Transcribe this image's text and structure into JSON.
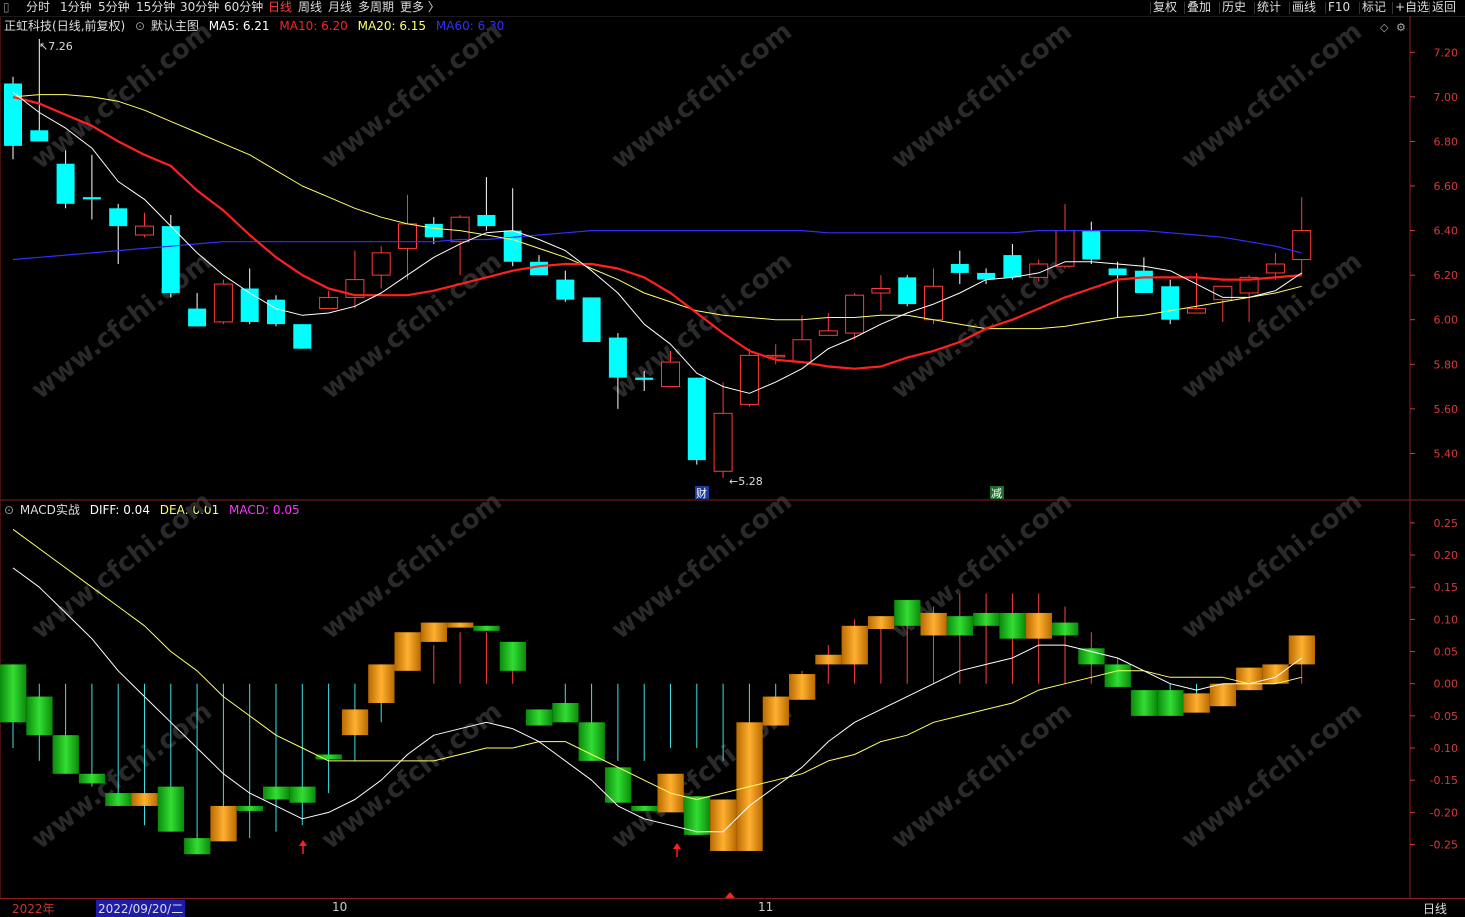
{
  "toolbar": {
    "periods": [
      {
        "label": "分时",
        "active": false
      },
      {
        "label": "1分钟",
        "active": false
      },
      {
        "label": "5分钟",
        "active": false
      },
      {
        "label": "15分钟",
        "active": false
      },
      {
        "label": "30分钟",
        "active": false
      },
      {
        "label": "60分钟",
        "active": false
      },
      {
        "label": "日线",
        "active": true
      },
      {
        "label": "周线",
        "active": false
      },
      {
        "label": "月线",
        "active": false
      },
      {
        "label": "多周期",
        "active": false
      },
      {
        "label": "更多 〉",
        "active": false
      }
    ],
    "right_buttons": [
      "复权",
      "叠加",
      "历史",
      "统计",
      "画线",
      "F10",
      "标记",
      "+自选",
      "返回"
    ]
  },
  "main_legend": {
    "stock": "正虹科技",
    "mode": "(日线,前复权)",
    "template": "默认主图",
    "ma5_label": "MA5:",
    "ma5_value": "6.21",
    "ma10_label": "MA10:",
    "ma10_value": "6.20",
    "ma20_label": "MA20:",
    "ma20_value": "6.15",
    "ma60_label": "MA60:",
    "ma60_value": "6.30"
  },
  "sub_legend": {
    "name": "MACD实战",
    "diff_label": "DIFF:",
    "diff_value": "0.04",
    "dea_label": "DEA:",
    "dea_value": "0.01",
    "macd_label": "MACD:",
    "macd_value": "0.05"
  },
  "price_axis": [
    "7.20",
    "7.00",
    "6.80",
    "6.60",
    "6.40",
    "6.20",
    "6.00",
    "5.80",
    "5.60",
    "5.40"
  ],
  "macd_axis": [
    "0.25",
    "0.20",
    "0.15",
    "0.10",
    "0.05",
    "0.00",
    "-0.05",
    "-0.10",
    "-0.15",
    "-0.20",
    "-0.25"
  ],
  "annotations": {
    "high_label": "7.26",
    "low_label": "5.28",
    "event_cai": "财",
    "event_jian": "减"
  },
  "watermark": "www.cfchi.com",
  "bottom": {
    "year": "2022年",
    "cursor_date": "2022/09/20/二",
    "month_oct": "10",
    "month_nov": "11",
    "period": "日线"
  },
  "colors": {
    "up": "#ff3a3a",
    "down": "#00ffff",
    "ma5": "#ffffff",
    "ma10": "#ff2020",
    "ma20": "#ffff66",
    "ma60": "#3030ff",
    "axis": "#d43c3c"
  },
  "chart_data": {
    "type": "candlestick",
    "price_ylim": [
      5.2,
      7.3
    ],
    "candles": [
      {
        "o": 7.06,
        "c": 6.78,
        "h": 7.09,
        "l": 6.72
      },
      {
        "o": 6.85,
        "c": 6.8,
        "h": 7.26,
        "l": 6.8
      },
      {
        "o": 6.7,
        "c": 6.52,
        "h": 6.76,
        "l": 6.5
      },
      {
        "o": 6.55,
        "c": 6.54,
        "h": 6.74,
        "l": 6.45
      },
      {
        "o": 6.5,
        "c": 6.42,
        "h": 6.52,
        "l": 6.25
      },
      {
        "o": 6.38,
        "c": 6.42,
        "h": 6.48,
        "l": 6.37
      },
      {
        "o": 6.42,
        "c": 6.12,
        "h": 6.47,
        "l": 6.1
      },
      {
        "o": 6.05,
        "c": 5.97,
        "h": 6.12,
        "l": 5.97
      },
      {
        "o": 5.99,
        "c": 6.16,
        "h": 6.18,
        "l": 5.98
      },
      {
        "o": 6.14,
        "c": 5.99,
        "h": 6.23,
        "l": 5.98
      },
      {
        "o": 6.09,
        "c": 5.98,
        "h": 6.11,
        "l": 5.97
      },
      {
        "o": 5.98,
        "c": 5.87,
        "h": 5.98,
        "l": 5.87
      },
      {
        "o": 6.05,
        "c": 6.1,
        "h": 6.13,
        "l": 6.05
      },
      {
        "o": 6.1,
        "c": 6.18,
        "h": 6.31,
        "l": 6.05
      },
      {
        "o": 6.2,
        "c": 6.3,
        "h": 6.33,
        "l": 6.14
      },
      {
        "o": 6.32,
        "c": 6.43,
        "h": 6.56,
        "l": 6.18
      },
      {
        "o": 6.43,
        "c": 6.37,
        "h": 6.46,
        "l": 6.34
      },
      {
        "o": 6.35,
        "c": 6.46,
        "h": 6.47,
        "l": 6.2
      },
      {
        "o": 6.47,
        "c": 6.42,
        "h": 6.64,
        "l": 6.4
      },
      {
        "o": 6.4,
        "c": 6.26,
        "h": 6.59,
        "l": 6.24
      },
      {
        "o": 6.26,
        "c": 6.2,
        "h": 6.29,
        "l": 6.2
      },
      {
        "o": 6.18,
        "c": 6.09,
        "h": 6.22,
        "l": 6.08
      },
      {
        "o": 6.1,
        "c": 5.9,
        "h": 6.1,
        "l": 5.9
      },
      {
        "o": 5.92,
        "c": 5.74,
        "h": 5.94,
        "l": 5.6
      },
      {
        "o": 5.74,
        "c": 5.73,
        "h": 5.77,
        "l": 5.68
      },
      {
        "o": 5.7,
        "c": 5.81,
        "h": 5.86,
        "l": 5.7
      },
      {
        "o": 5.74,
        "c": 5.37,
        "h": 5.74,
        "l": 5.35
      },
      {
        "o": 5.32,
        "c": 5.58,
        "h": 5.72,
        "l": 5.29
      },
      {
        "o": 5.62,
        "c": 5.84,
        "h": 5.87,
        "l": 5.61
      },
      {
        "o": 5.84,
        "c": 5.84,
        "h": 5.89,
        "l": 5.8
      },
      {
        "o": 5.81,
        "c": 5.91,
        "h": 6.02,
        "l": 5.81
      },
      {
        "o": 5.93,
        "c": 5.95,
        "h": 6.03,
        "l": 5.93
      },
      {
        "o": 5.94,
        "c": 6.11,
        "h": 6.12,
        "l": 5.91
      },
      {
        "o": 6.12,
        "c": 6.14,
        "h": 6.2,
        "l": 6.04
      },
      {
        "o": 6.19,
        "c": 6.07,
        "h": 6.2,
        "l": 6.06
      },
      {
        "o": 6.0,
        "c": 6.15,
        "h": 6.23,
        "l": 5.98
      },
      {
        "o": 6.25,
        "c": 6.21,
        "h": 6.31,
        "l": 6.16
      },
      {
        "o": 6.21,
        "c": 6.18,
        "h": 6.23,
        "l": 6.16
      },
      {
        "o": 6.29,
        "c": 6.19,
        "h": 6.34,
        "l": 6.18
      },
      {
        "o": 6.19,
        "c": 6.25,
        "h": 6.27,
        "l": 6.17
      },
      {
        "o": 6.24,
        "c": 6.4,
        "h": 6.52,
        "l": 6.23
      },
      {
        "o": 6.4,
        "c": 6.27,
        "h": 6.44,
        "l": 6.25
      },
      {
        "o": 6.23,
        "c": 6.2,
        "h": 6.26,
        "l": 6.01
      },
      {
        "o": 6.22,
        "c": 6.12,
        "h": 6.28,
        "l": 6.12
      },
      {
        "o": 6.15,
        "c": 6.0,
        "h": 6.18,
        "l": 5.98
      },
      {
        "o": 6.03,
        "c": 6.05,
        "h": 6.21,
        "l": 6.03
      },
      {
        "o": 6.09,
        "c": 6.15,
        "h": 6.15,
        "l": 5.99
      },
      {
        "o": 6.12,
        "c": 6.19,
        "h": 6.2,
        "l": 5.99
      },
      {
        "o": 6.21,
        "c": 6.25,
        "h": 6.3,
        "l": 6.18
      },
      {
        "o": 6.27,
        "c": 6.4,
        "h": 6.55,
        "l": 6.2
      }
    ],
    "ma5": [
      7.02,
      6.93,
      6.86,
      6.77,
      6.62,
      6.54,
      6.42,
      6.3,
      6.2,
      6.12,
      6.05,
      6.02,
      6.03,
      6.06,
      6.12,
      6.2,
      6.28,
      6.34,
      6.39,
      6.4,
      6.36,
      6.31,
      6.22,
      6.12,
      5.98,
      5.89,
      5.76,
      5.7,
      5.67,
      5.72,
      5.78,
      5.87,
      5.92,
      5.98,
      6.03,
      6.07,
      6.12,
      6.18,
      6.19,
      6.21,
      6.26,
      6.26,
      6.25,
      6.24,
      6.22,
      6.16,
      6.1,
      6.1,
      6.13,
      6.21
    ],
    "ma10": [
      7.0,
      6.97,
      6.92,
      6.87,
      6.8,
      6.74,
      6.69,
      6.58,
      6.49,
      6.38,
      6.28,
      6.2,
      6.14,
      6.11,
      6.11,
      6.11,
      6.13,
      6.16,
      6.19,
      6.22,
      6.24,
      6.25,
      6.25,
      6.23,
      6.19,
      6.12,
      6.03,
      5.94,
      5.86,
      5.82,
      5.81,
      5.79,
      5.78,
      5.79,
      5.83,
      5.86,
      5.9,
      5.96,
      6.0,
      6.05,
      6.1,
      6.14,
      6.18,
      6.19,
      6.19,
      6.19,
      6.18,
      6.18,
      6.19,
      6.2
    ],
    "ma20": [
      7.0,
      7.01,
      7.01,
      7.0,
      6.98,
      6.94,
      6.89,
      6.84,
      6.79,
      6.74,
      6.67,
      6.6,
      6.55,
      6.5,
      6.46,
      6.43,
      6.41,
      6.4,
      6.38,
      6.36,
      6.32,
      6.28,
      6.23,
      6.18,
      6.12,
      6.08,
      6.04,
      6.02,
      6.01,
      6.0,
      6.0,
      6.01,
      6.01,
      6.02,
      6.02,
      6.0,
      5.98,
      5.96,
      5.96,
      5.96,
      5.97,
      5.99,
      6.01,
      6.02,
      6.04,
      6.06,
      6.08,
      6.1,
      6.12,
      6.15
    ],
    "ma60": [
      6.27,
      6.28,
      6.29,
      6.3,
      6.31,
      6.32,
      6.33,
      6.34,
      6.35,
      6.35,
      6.35,
      6.35,
      6.35,
      6.35,
      6.35,
      6.35,
      6.35,
      6.36,
      6.36,
      6.37,
      6.38,
      6.39,
      6.4,
      6.4,
      6.4,
      6.4,
      6.4,
      6.4,
      6.4,
      6.4,
      6.4,
      6.39,
      6.39,
      6.39,
      6.39,
      6.39,
      6.39,
      6.39,
      6.39,
      6.4,
      6.4,
      6.4,
      6.4,
      6.4,
      6.39,
      6.38,
      6.37,
      6.35,
      6.33,
      6.3
    ],
    "macd_ylim": [
      -0.33,
      0.27
    ],
    "diff": [
      0.18,
      0.15,
      0.11,
      0.07,
      0.02,
      -0.02,
      -0.06,
      -0.1,
      -0.14,
      -0.17,
      -0.19,
      -0.21,
      -0.2,
      -0.18,
      -0.15,
      -0.11,
      -0.08,
      -0.07,
      -0.06,
      -0.07,
      -0.09,
      -0.12,
      -0.15,
      -0.19,
      -0.21,
      -0.22,
      -0.23,
      -0.23,
      -0.19,
      -0.16,
      -0.13,
      -0.09,
      -0.06,
      -0.04,
      -0.02,
      0.0,
      0.02,
      0.03,
      0.04,
      0.06,
      0.06,
      0.05,
      0.04,
      0.02,
      0.0,
      -0.01,
      0.0,
      0.0,
      0.01,
      0.04
    ],
    "dea": [
      0.24,
      0.21,
      0.18,
      0.15,
      0.12,
      0.09,
      0.05,
      0.02,
      -0.02,
      -0.05,
      -0.08,
      -0.1,
      -0.12,
      -0.12,
      -0.12,
      -0.12,
      -0.12,
      -0.11,
      -0.1,
      -0.1,
      -0.09,
      -0.09,
      -0.11,
      -0.13,
      -0.15,
      -0.17,
      -0.18,
      -0.17,
      -0.16,
      -0.15,
      -0.14,
      -0.12,
      -0.11,
      -0.09,
      -0.08,
      -0.06,
      -0.05,
      -0.04,
      -0.03,
      -0.01,
      0.0,
      0.01,
      0.02,
      0.02,
      0.01,
      0.01,
      0.01,
      0.0,
      0.0,
      0.01
    ],
    "macd": [
      -0.1,
      -0.12,
      -0.14,
      -0.16,
      -0.19,
      -0.22,
      -0.22,
      -0.24,
      -0.24,
      -0.24,
      -0.23,
      -0.22,
      -0.17,
      -0.12,
      -0.06,
      0.0,
      0.06,
      0.08,
      0.08,
      0.06,
      0.0,
      -0.06,
      -0.08,
      -0.12,
      -0.12,
      -0.1,
      -0.1,
      -0.12,
      -0.06,
      -0.02,
      0.02,
      0.06,
      0.1,
      0.1,
      0.12,
      0.12,
      0.14,
      0.14,
      0.14,
      0.14,
      0.12,
      0.08,
      0.04,
      0.0,
      -0.02,
      -0.04,
      -0.02,
      0.0,
      0.02,
      0.05
    ],
    "histogram_blocks": [
      {
        "i": 0,
        "a": 0.03,
        "b": -0.06,
        "c": "g"
      },
      {
        "i": 1,
        "a": -0.02,
        "b": -0.08,
        "c": "g"
      },
      {
        "i": 2,
        "a": -0.08,
        "b": -0.14,
        "c": "g"
      },
      {
        "i": 3,
        "a": -0.14,
        "b": -0.155,
        "c": "g"
      },
      {
        "i": 4,
        "a": -0.17,
        "b": -0.19,
        "c": "g"
      },
      {
        "i": 5,
        "a": -0.17,
        "b": -0.19,
        "c": "o"
      },
      {
        "i": 6,
        "a": -0.16,
        "b": -0.23,
        "c": "g"
      },
      {
        "i": 7,
        "a": -0.24,
        "b": -0.265,
        "c": "g"
      },
      {
        "i": 8,
        "a": -0.19,
        "b": -0.245,
        "c": "o"
      },
      {
        "i": 9,
        "a": -0.19,
        "b": -0.195,
        "c": "g"
      },
      {
        "i": 10,
        "a": -0.16,
        "b": -0.18,
        "c": "g"
      },
      {
        "i": 11,
        "a": -0.16,
        "b": -0.185,
        "c": "g"
      },
      {
        "i": 12,
        "a": -0.11,
        "b": -0.115,
        "c": "g"
      },
      {
        "i": 13,
        "a": -0.04,
        "b": -0.08,
        "c": "o"
      },
      {
        "i": 14,
        "a": 0.03,
        "b": -0.03,
        "c": "o"
      },
      {
        "i": 15,
        "a": 0.08,
        "b": 0.02,
        "c": "o"
      },
      {
        "i": 16,
        "a": 0.095,
        "b": 0.065,
        "c": "o"
      },
      {
        "i": 17,
        "a": 0.095,
        "b": 0.095,
        "c": "o"
      },
      {
        "i": 18,
        "a": 0.09,
        "b": 0.085,
        "c": "g"
      },
      {
        "i": 19,
        "a": 0.065,
        "b": 0.02,
        "c": "g"
      },
      {
        "i": 20,
        "a": -0.04,
        "b": -0.065,
        "c": "g"
      },
      {
        "i": 21,
        "a": -0.03,
        "b": -0.06,
        "c": "g"
      },
      {
        "i": 22,
        "a": -0.06,
        "b": -0.12,
        "c": "g"
      },
      {
        "i": 23,
        "a": -0.13,
        "b": -0.185,
        "c": "g"
      },
      {
        "i": 24,
        "a": -0.19,
        "b": -0.195,
        "c": "g"
      },
      {
        "i": 25,
        "a": -0.14,
        "b": -0.2,
        "c": "o"
      },
      {
        "i": 26,
        "a": -0.175,
        "b": -0.235,
        "c": "g"
      },
      {
        "i": 27,
        "a": -0.18,
        "b": -0.26,
        "c": "o"
      },
      {
        "i": 28,
        "a": -0.06,
        "b": -0.26,
        "c": "o"
      },
      {
        "i": 29,
        "a": -0.02,
        "b": -0.065,
        "c": "o"
      },
      {
        "i": 30,
        "a": 0.015,
        "b": -0.025,
        "c": "o"
      },
      {
        "i": 31,
        "a": 0.045,
        "b": 0.03,
        "c": "o"
      },
      {
        "i": 32,
        "a": 0.09,
        "b": 0.03,
        "c": "o"
      },
      {
        "i": 33,
        "a": 0.105,
        "b": 0.085,
        "c": "o"
      },
      {
        "i": 34,
        "a": 0.13,
        "b": 0.09,
        "c": "g"
      },
      {
        "i": 35,
        "a": 0.11,
        "b": 0.075,
        "c": "o"
      },
      {
        "i": 36,
        "a": 0.105,
        "b": 0.075,
        "c": "g"
      },
      {
        "i": 37,
        "a": 0.11,
        "b": 0.09,
        "c": "g"
      },
      {
        "i": 38,
        "a": 0.11,
        "b": 0.07,
        "c": "g"
      },
      {
        "i": 39,
        "a": 0.11,
        "b": 0.07,
        "c": "o"
      },
      {
        "i": 40,
        "a": 0.095,
        "b": 0.075,
        "c": "g"
      },
      {
        "i": 41,
        "a": 0.055,
        "b": 0.03,
        "c": "g"
      },
      {
        "i": 42,
        "a": 0.03,
        "b": -0.005,
        "c": "g"
      },
      {
        "i": 43,
        "a": -0.01,
        "b": -0.05,
        "c": "g"
      },
      {
        "i": 44,
        "a": -0.01,
        "b": -0.05,
        "c": "g"
      },
      {
        "i": 45,
        "a": -0.015,
        "b": -0.045,
        "c": "o"
      },
      {
        "i": 46,
        "a": 0.0,
        "b": -0.035,
        "c": "o"
      },
      {
        "i": 47,
        "a": 0.025,
        "b": -0.01,
        "c": "o"
      },
      {
        "i": 48,
        "a": 0.03,
        "b": 0.0,
        "c": "o"
      },
      {
        "i": 49,
        "a": 0.075,
        "b": 0.03,
        "c": "o"
      }
    ]
  }
}
